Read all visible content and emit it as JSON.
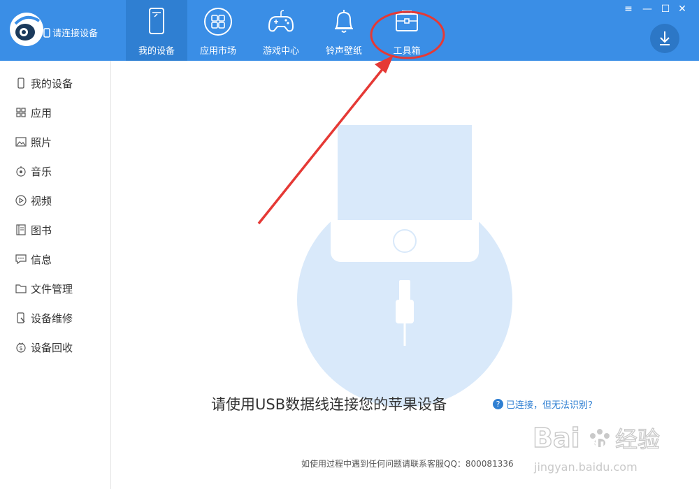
{
  "header": {
    "device_status": "请连接设备",
    "tabs": [
      {
        "label": "我的设备",
        "icon": "phone-icon",
        "active": true
      },
      {
        "label": "应用市场",
        "icon": "app-grid-icon",
        "active": false
      },
      {
        "label": "游戏中心",
        "icon": "gamepad-icon",
        "active": false
      },
      {
        "label": "铃声壁纸",
        "icon": "bell-icon",
        "active": false
      },
      {
        "label": "工具箱",
        "icon": "toolbox-icon",
        "active": false
      }
    ],
    "window_controls": {
      "menu": "≡",
      "minimize": "—",
      "maximize": "☐",
      "close": "✕"
    }
  },
  "sidebar": {
    "items": [
      {
        "label": "我的设备",
        "icon": "phone-icon"
      },
      {
        "label": "应用",
        "icon": "grid-icon"
      },
      {
        "label": "照片",
        "icon": "image-icon"
      },
      {
        "label": "音乐",
        "icon": "music-icon"
      },
      {
        "label": "视频",
        "icon": "play-icon"
      },
      {
        "label": "图书",
        "icon": "book-icon"
      },
      {
        "label": "信息",
        "icon": "message-icon"
      },
      {
        "label": "文件管理",
        "icon": "folder-icon"
      },
      {
        "label": "设备维修",
        "icon": "repair-icon"
      },
      {
        "label": "设备回收",
        "icon": "recycle-icon"
      }
    ]
  },
  "main": {
    "connect_text": "请使用USB数据线连接您的苹果设备",
    "help_icon": "?",
    "help_link": "已连接，但无法识别？",
    "footer_note": "如使用过程中遇到任何问题请联系客服QQ：800081336"
  },
  "watermark": {
    "brand_latin": "Bai",
    "brand_latin2": "du",
    "brand_cn": "经验",
    "url": "jingyan.baidu.com"
  },
  "colors": {
    "header_blue": "#3a8ee6",
    "active_tab": "#2f7fd2",
    "annotation_red": "#e53935",
    "illustration_blue": "#d9e9fa"
  }
}
